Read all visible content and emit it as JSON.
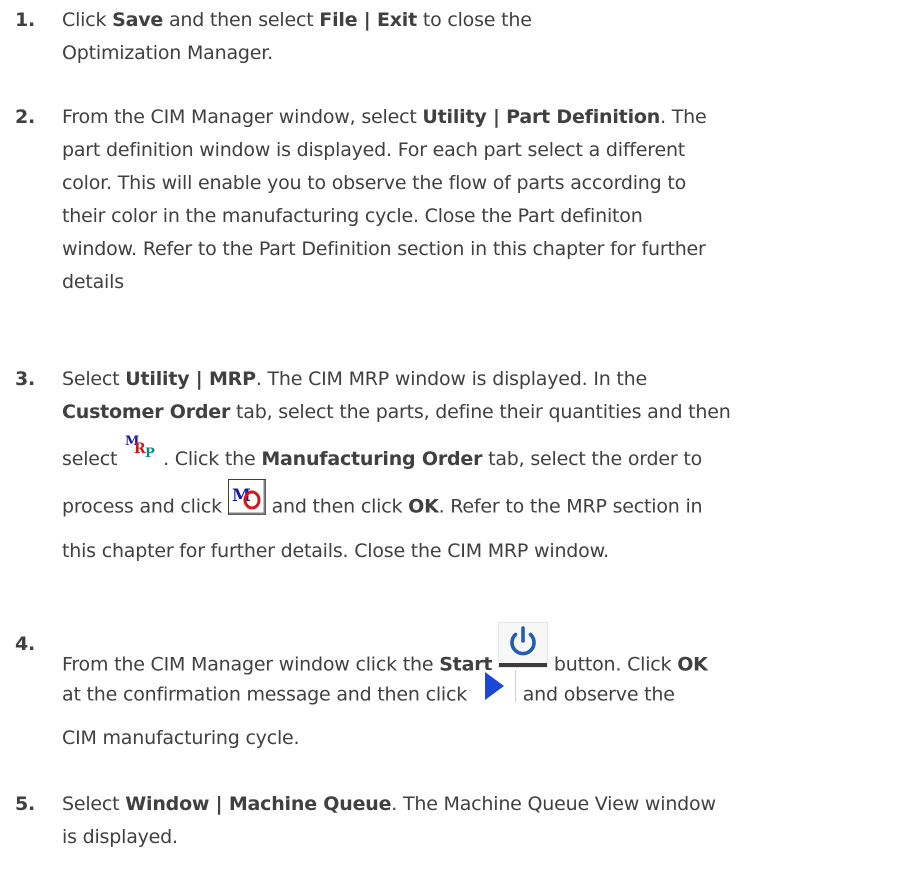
{
  "steps": [
    {
      "number": "1.",
      "lines": [
        [
          "Click ",
          {
            "b": "Save"
          },
          " and then select ",
          {
            "b": "File | Exit"
          },
          " to close the"
        ],
        [
          "Optimization Manager."
        ]
      ]
    },
    {
      "number": "2.",
      "lines": [
        [
          "From the CIM Manager window, select ",
          {
            "b": "Utility | Part Definition"
          },
          ". The"
        ],
        [
          "part definition window is displayed. For each part select a different"
        ],
        [
          "color. This will enable you to observe the flow of parts according to"
        ],
        [
          "their color in the manufacturing cycle. Close the Part definiton"
        ],
        [
          "window. Refer to the Part Definition section in this chapter for further"
        ],
        [
          "details"
        ]
      ]
    },
    {
      "number": "3.",
      "lines": [
        [
          "Select ",
          {
            "b": "Utility | MRP"
          },
          ". The CIM MRP window is displayed. In the"
        ],
        [
          {
            "b": "Customer Order"
          },
          " tab, select the parts, define their quantities and then"
        ],
        [
          "select ",
          {
            "icon": "mrp"
          },
          ". Click the ",
          {
            "b": "Manufacturing Order"
          },
          " tab, select the order to"
        ],
        [
          "process and click ",
          {
            "icon": "mo"
          },
          " and then click ",
          {
            "b": "OK"
          },
          ". Refer to the MRP section in"
        ],
        [
          "this chapter for further details. Close the CIM MRP window."
        ]
      ]
    },
    {
      "number": "4.",
      "lines": [
        [
          "From the CIM Manager window click the ",
          {
            "b": "Start"
          },
          " ",
          {
            "icon": "power"
          },
          " button. Click ",
          {
            "b": "OK"
          }
        ],
        [
          "at the confirmation message and then click ",
          {
            "icon": "play"
          },
          " and observe the"
        ],
        [
          "CIM manufacturing cycle."
        ]
      ]
    },
    {
      "number": "5.",
      "lines": [
        [
          "Select ",
          {
            "b": "Window | Machine Queue"
          },
          ". The Machine Queue View window"
        ],
        [
          "is displayed."
        ]
      ]
    }
  ],
  "icons": {
    "mrp": {
      "name": "mrp-icon",
      "text_m": "M",
      "text_r": "R",
      "text_p": "P",
      "color_m": "#1a1aa8",
      "color_r": "#d01818",
      "color_p": "#0a8a8a"
    },
    "mo": {
      "name": "manufacturing-order-icon",
      "text_m": "M",
      "text_o": "O",
      "color_m": "#1a1aa8",
      "color_o": "#d01818"
    },
    "power": {
      "name": "power-icon",
      "color": "#1f5fb0"
    },
    "play": {
      "name": "play-icon",
      "color": "#1a47d6"
    }
  }
}
